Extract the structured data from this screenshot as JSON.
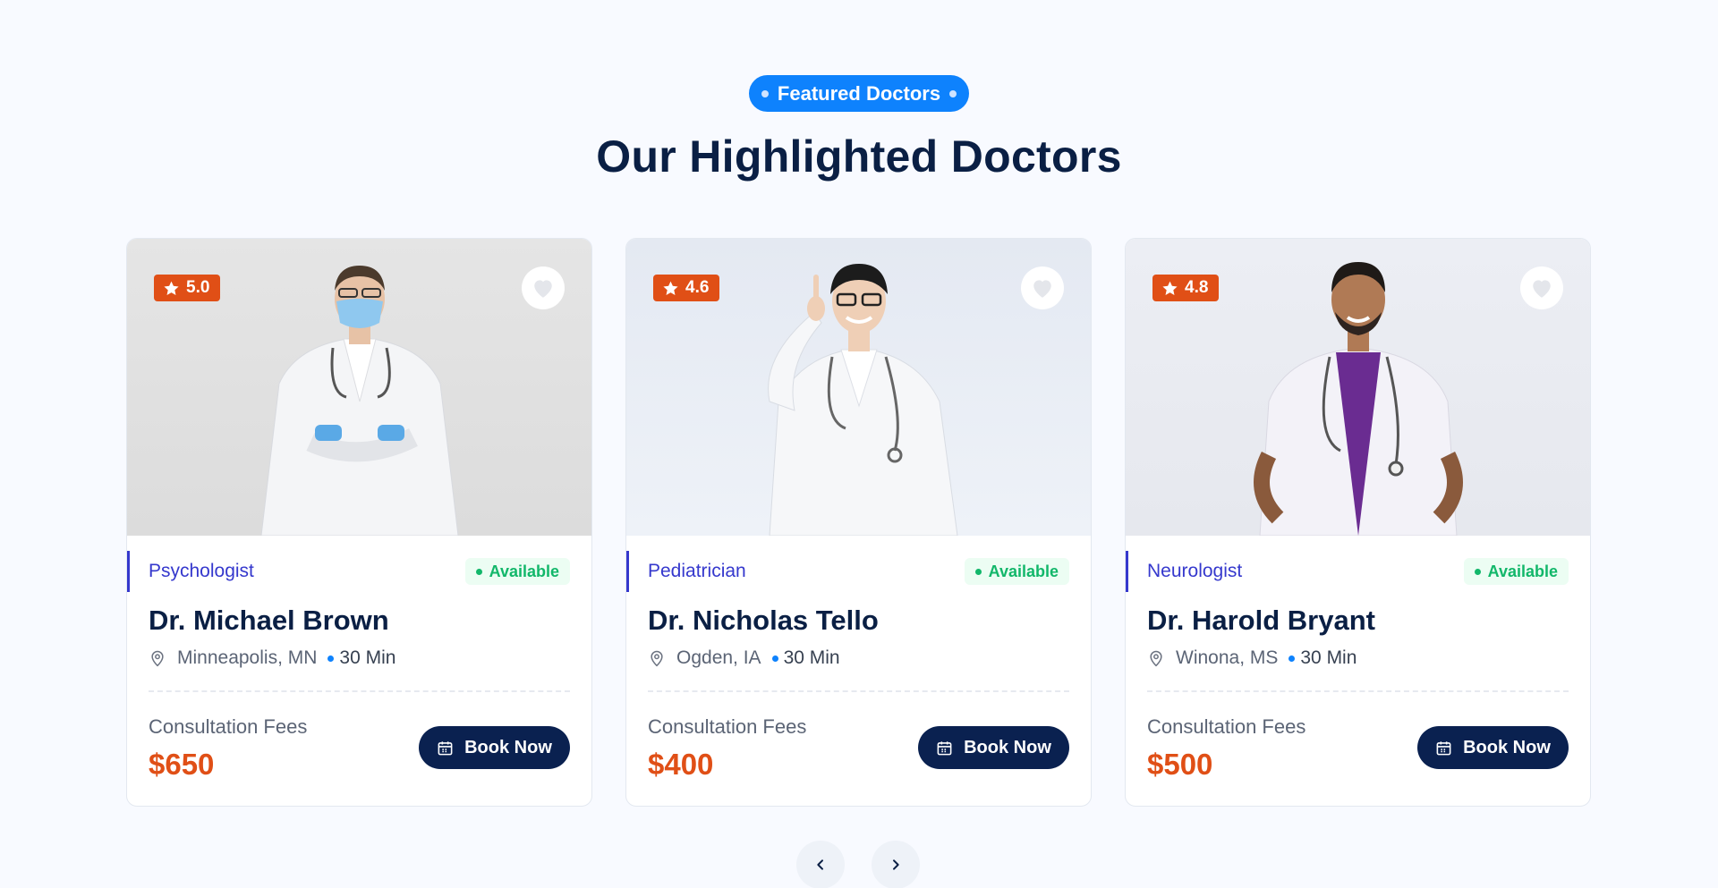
{
  "section": {
    "badge": "Featured Doctors",
    "title": "Our Highlighted Doctors"
  },
  "colors": {
    "accent_blue": "#0e82fd",
    "navy": "#0a2150",
    "price_orange": "#e04f16",
    "specialty_indigo": "#3538cd",
    "available_green": "#12b76a"
  },
  "doctors": [
    {
      "rating": "5.0",
      "specialty": "Psychologist",
      "status": "Available",
      "name": "Dr. Michael Brown",
      "location": "Minneapolis, MN",
      "duration": "30 Min",
      "fees_label": "Consultation Fees",
      "price": "$650",
      "book_label": "Book Now"
    },
    {
      "rating": "4.6",
      "specialty": "Pediatrician",
      "status": "Available",
      "name": "Dr. Nicholas Tello",
      "location": "Ogden, IA",
      "duration": "30 Min",
      "fees_label": "Consultation Fees",
      "price": "$400",
      "book_label": "Book Now"
    },
    {
      "rating": "4.8",
      "specialty": "Neurologist",
      "status": "Available",
      "name": "Dr. Harold Bryant",
      "location": "Winona, MS",
      "duration": "30 Min",
      "fees_label": "Consultation Fees",
      "price": "$500",
      "book_label": "Book Now"
    }
  ],
  "icons": {
    "rating": "star-icon",
    "favorite": "heart-icon",
    "location": "map-pin-icon",
    "book": "calendar-icon",
    "prev": "chevron-left-icon",
    "next": "chevron-right-icon"
  }
}
